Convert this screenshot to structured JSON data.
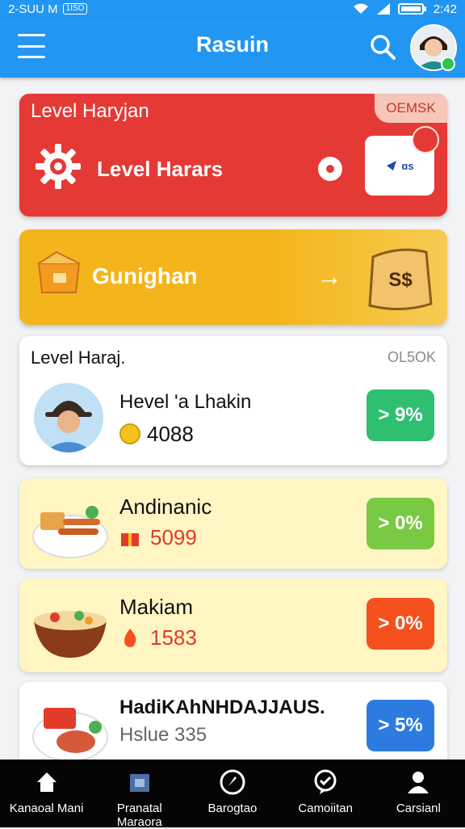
{
  "status_bar": {
    "left_text": "2-SUU M",
    "chip": "1ISO",
    "time": "2:42"
  },
  "app_bar": {
    "title": "Rasuin"
  },
  "cards": {
    "level_card": {
      "title": "Level Haryjan",
      "badge": "OEMSK",
      "label": "Level Harars",
      "mini_text": "ɑs"
    },
    "gunighan_card": {
      "label": "Gunighan",
      "arrow": "→",
      "pouch_text": "S$"
    },
    "profile_card": {
      "title": "Level Haraj.",
      "corner": "OL5OK",
      "name": "Hevel 'a Lhakin",
      "value": "4088",
      "percent": "> 9%"
    },
    "andinanic_card": {
      "name": "Andinanic",
      "value": "5099",
      "percent": "> 0%"
    },
    "makiam_card": {
      "name": "Makiam",
      "value": "1583",
      "percent": "> 0%"
    },
    "hadik_card": {
      "name": "HadiKAhNHDAJJAUS.",
      "sub": "Hslue 335",
      "percent": "> 5%"
    }
  },
  "colors": {
    "primary": "#2196f3",
    "red": "#e53935",
    "yellow": "#f3b51b",
    "green": "#2fbf71",
    "lime": "#7ac943",
    "orange": "#f4511e",
    "blue": "#2d7be0"
  },
  "bottom_nav": [
    {
      "label": "Kanaoal Mani",
      "icon": "home-icon"
    },
    {
      "label": "Pranatal Maraora",
      "icon": "store-icon"
    },
    {
      "label": "Barogtao",
      "icon": "compass-icon"
    },
    {
      "label": "Camoiitan",
      "icon": "chat-icon"
    },
    {
      "label": "Carsianl",
      "icon": "person-icon"
    }
  ]
}
